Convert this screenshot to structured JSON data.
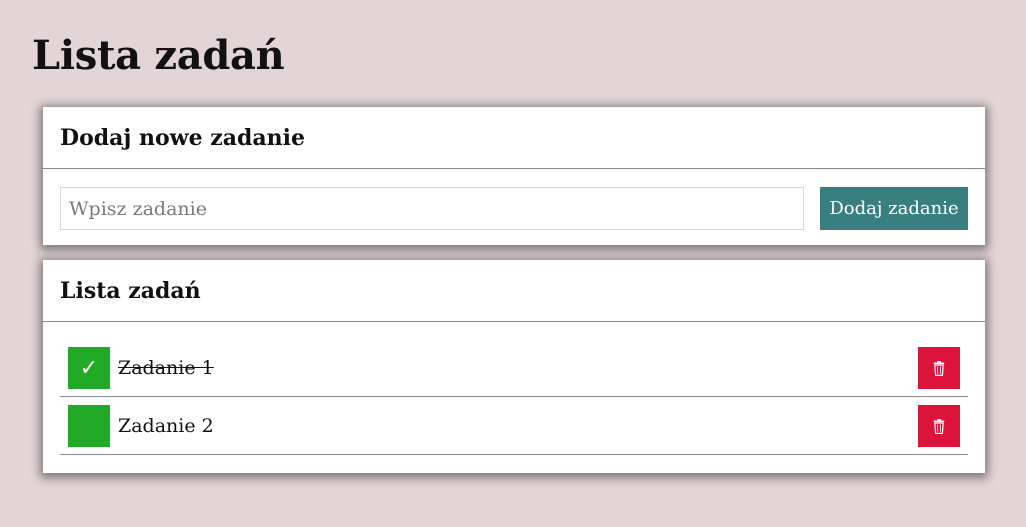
{
  "page": {
    "title": "Lista zadań",
    "background": "#e3d5d7"
  },
  "add_panel": {
    "heading": "Dodaj nowe zadanie",
    "input": {
      "placeholder": "Wpisz zadanie",
      "value": ""
    },
    "button_label": "Dodaj zadanie",
    "button_color": "#3a7f80"
  },
  "list_panel": {
    "heading": "Lista zadań",
    "tasks": [
      {
        "label": "Zadanie 1",
        "completed": true,
        "check_mark": "✓"
      },
      {
        "label": "Zadanie 2",
        "completed": false,
        "check_mark": ""
      }
    ],
    "check_color": "#21a927",
    "delete_color": "#dc143c",
    "delete_icon": "trash-icon"
  }
}
